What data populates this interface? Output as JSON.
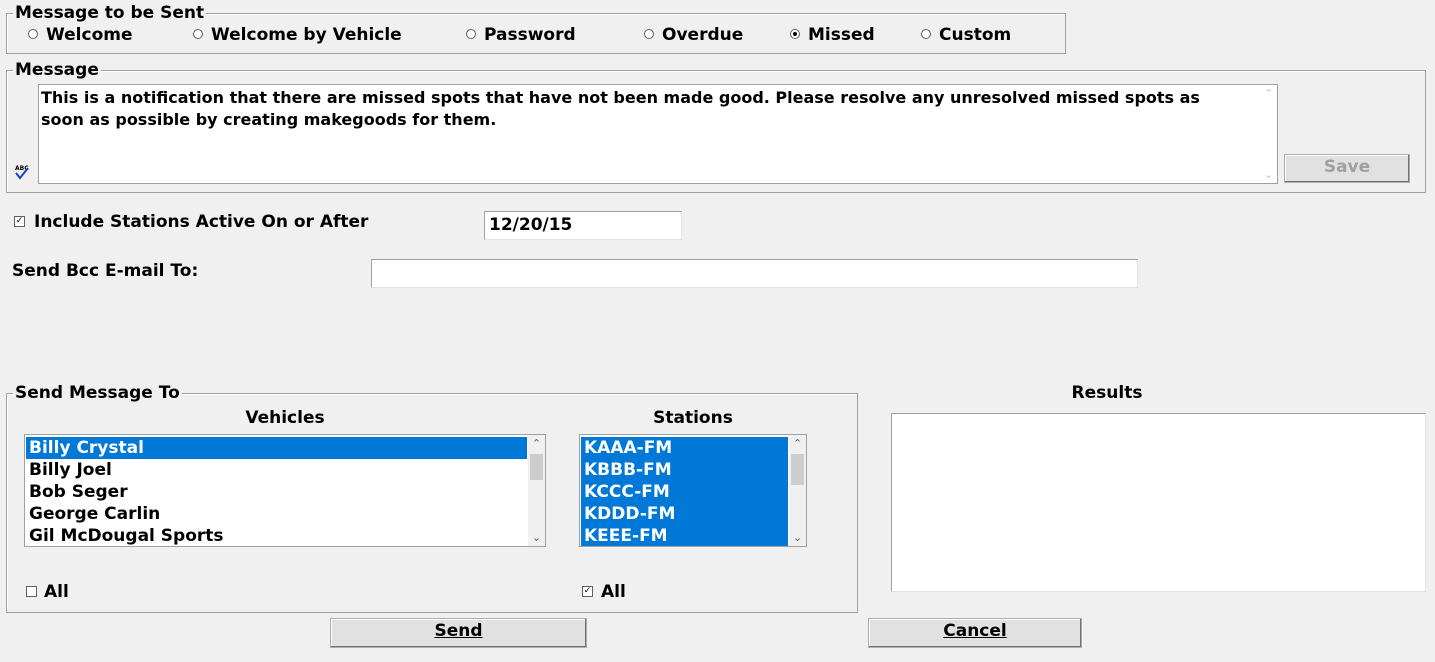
{
  "message_group": {
    "title": "Message to be Sent",
    "options": [
      {
        "label": "Welcome",
        "selected": false
      },
      {
        "label": "Welcome by Vehicle",
        "selected": false
      },
      {
        "label": "Password",
        "selected": false
      },
      {
        "label": "Overdue",
        "selected": false
      },
      {
        "label": "Missed",
        "selected": true
      },
      {
        "label": "Custom",
        "selected": false
      }
    ]
  },
  "message": {
    "title": "Message",
    "text": "This is a notification that there are missed spots that have not been made good. Please resolve any unresolved missed spots as soon as possible by creating makegoods for them.",
    "save_label": "Save"
  },
  "include_stations": {
    "label": "Include Stations Active On or After",
    "checked": true,
    "date": "12/20/15"
  },
  "bcc": {
    "label": "Send Bcc E-mail To:",
    "value": ""
  },
  "send_to": {
    "title": "Send Message To",
    "vehicles_header": "Vehicles",
    "stations_header": "Stations",
    "vehicles": [
      "Billy Crystal",
      "Billy Joel",
      "Bob Seger",
      "George Carlin",
      "Gil McDougal Sports"
    ],
    "stations": [
      "KAAA-FM",
      "KBBB-FM",
      "KCCC-FM",
      "KDDD-FM",
      "KEEE-FM"
    ],
    "vehicles_all_label": "All",
    "vehicles_all_checked": false,
    "stations_all_label": "All",
    "stations_all_checked": true
  },
  "results": {
    "title": "Results"
  },
  "buttons": {
    "send_label": "Send",
    "cancel_label": "Cancel"
  },
  "colors": {
    "selection": "#0078d7",
    "window_bg": "#f0f0f0"
  }
}
